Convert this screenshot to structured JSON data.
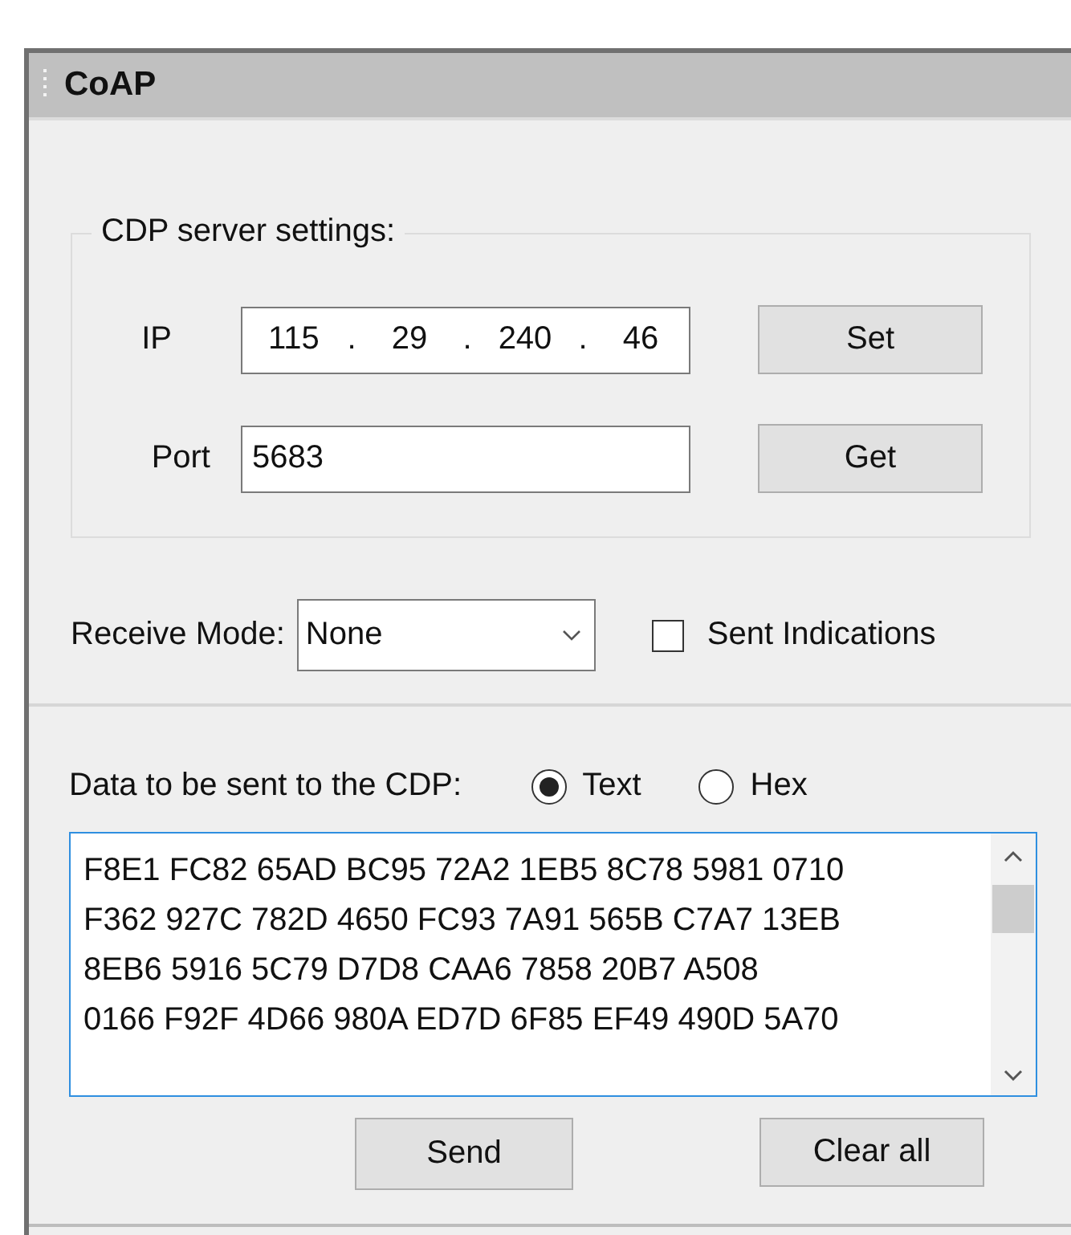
{
  "panel": {
    "title": "CoAP"
  },
  "server_settings": {
    "legend": "CDP server settings:",
    "ip": {
      "label": "IP",
      "octets": [
        "115",
        "29",
        "240",
        "46"
      ],
      "separator": "."
    },
    "port": {
      "label": "Port",
      "value": "5683"
    },
    "buttons": [
      "Set",
      "Get"
    ]
  },
  "receive_mode": {
    "label": "Receive Mode:",
    "value": "None"
  },
  "sent_indications": {
    "label": "Sent Indications",
    "checked": false
  },
  "data": {
    "label": "Data to be sent  to the CDP:",
    "formats": [
      {
        "label": "Text",
        "selected": true
      },
      {
        "label": "Hex",
        "selected": false
      }
    ],
    "lines": [
      "F8E1 FC82 65AD BC95 72A2 1EB5 8C78 5981 0710",
      "F362 927C 782D 4650 FC93 7A91 565B C7A7 13EB",
      "8EB6 5916 5C79 D7D8 CAA6 7858 20B7 A508",
      "0166 F92F 4D66 980A ED7D 6F85 EF49 490D 5A70"
    ]
  },
  "buttons": [
    "Send",
    "Clear all"
  ]
}
